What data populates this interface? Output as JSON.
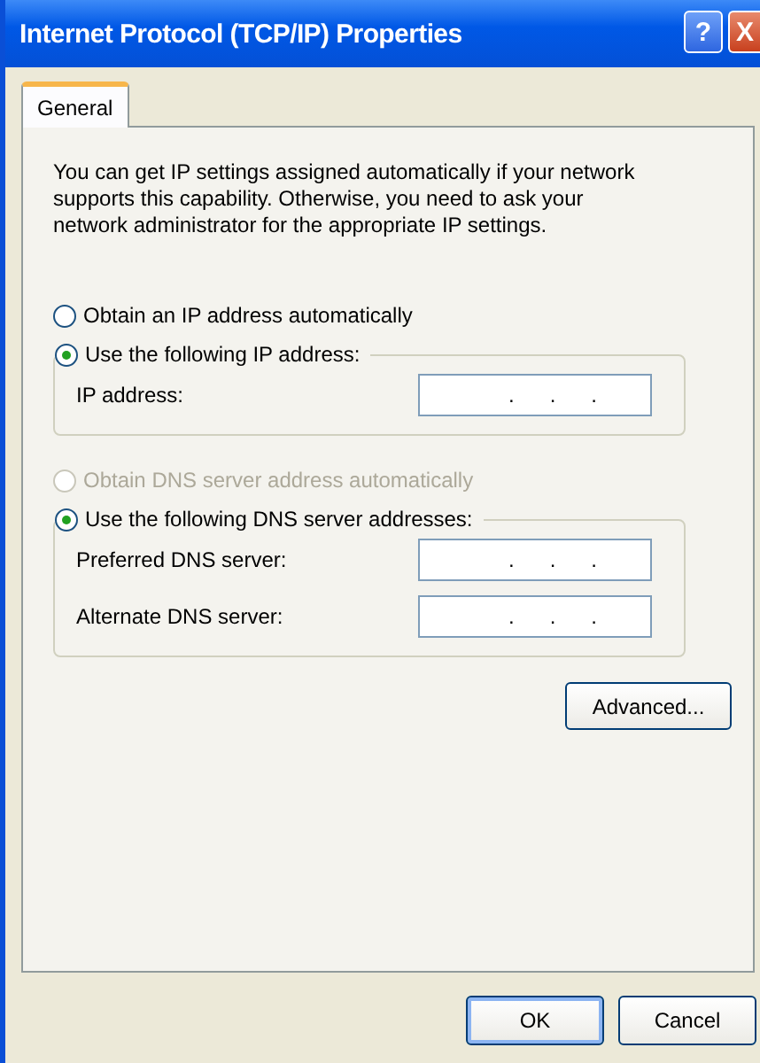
{
  "window": {
    "title": "Internet Protocol (TCP/IP) Properties",
    "controls": [
      {
        "kind": "help",
        "label": "?"
      },
      {
        "kind": "close",
        "label": "X"
      }
    ]
  },
  "tabs": [
    {
      "label": "General",
      "selected": true
    }
  ],
  "intro": "You can get IP settings assigned automatically if your network supports this capability. Otherwise, you need to ask your network administrator for the appropriate IP settings.",
  "ip": {
    "auto": {
      "label": "Obtain an IP address automatically",
      "selected": false,
      "disabled": false
    },
    "manual": {
      "label": "Use the following IP address:",
      "selected": true,
      "disabled": false
    },
    "fields": [
      {
        "label": "IP address:",
        "dots": [
          ".",
          ".",
          "."
        ]
      }
    ]
  },
  "dns": {
    "auto": {
      "label": "Obtain DNS server address automatically",
      "selected": false,
      "disabled": true
    },
    "manual": {
      "label": "Use the following DNS server addresses:",
      "selected": true,
      "disabled": false
    },
    "fields": [
      {
        "label": "Preferred DNS server:",
        "dots": [
          ".",
          ".",
          "."
        ]
      },
      {
        "label": "Alternate DNS server:",
        "dots": [
          ".",
          ".",
          "."
        ]
      }
    ]
  },
  "advanced_button": "Advanced...",
  "buttons": [
    {
      "label": "OK",
      "default": true
    },
    {
      "label": "Cancel",
      "default": false
    }
  ]
}
